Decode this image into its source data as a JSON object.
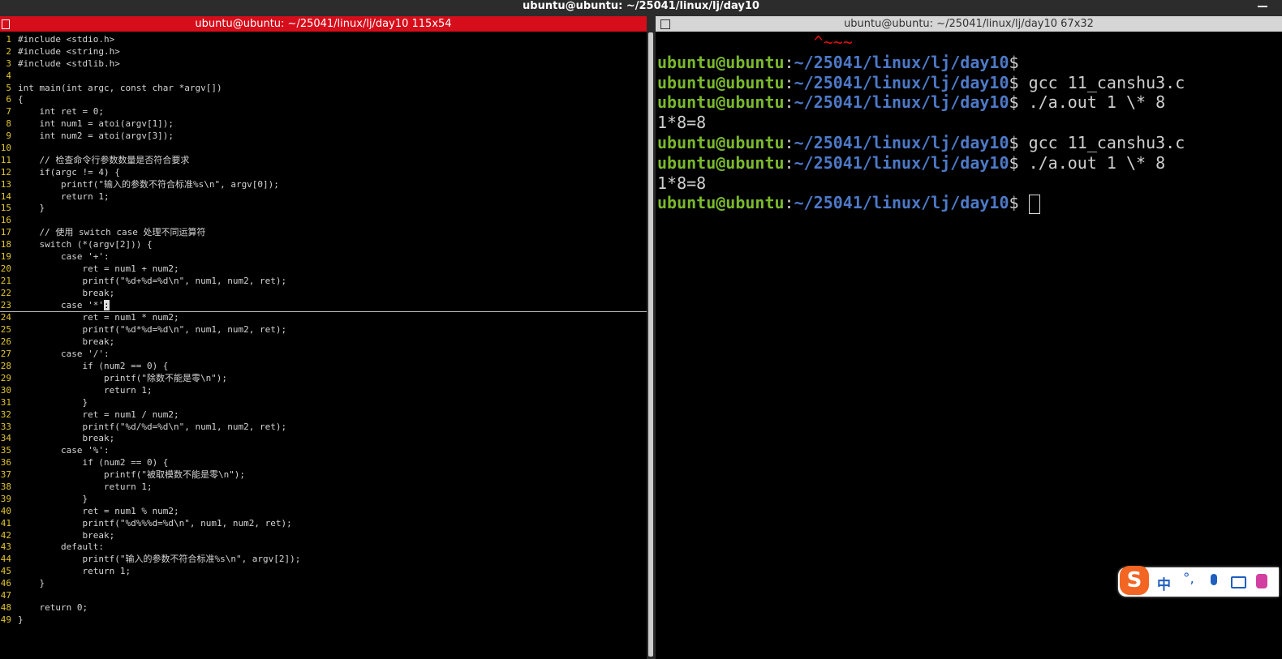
{
  "window": {
    "title": "ubuntu@ubuntu: ~/25041/linux/lj/day10"
  },
  "left_pane": {
    "title": "ubuntu@ubuntu: ~/25041/linux/lj/day10 115x54",
    "lines": [
      {
        "n": "1",
        "t": "#include <stdio.h>"
      },
      {
        "n": "2",
        "t": "#include <string.h>"
      },
      {
        "n": "3",
        "t": "#include <stdlib.h>"
      },
      {
        "n": "4",
        "t": ""
      },
      {
        "n": "5",
        "t": "int main(int argc, const char *argv[])"
      },
      {
        "n": "6",
        "t": "{"
      },
      {
        "n": "7",
        "t": "    int ret = 0;"
      },
      {
        "n": "8",
        "t": "    int num1 = atoi(argv[1]);"
      },
      {
        "n": "9",
        "t": "    int num2 = atoi(argv[3]);"
      },
      {
        "n": "10",
        "t": ""
      },
      {
        "n": "11",
        "t": "    // 检查命令行参数数量是否符合要求"
      },
      {
        "n": "12",
        "t": "    if(argc != 4) {"
      },
      {
        "n": "13",
        "t": "        printf(\"输入的参数不符合标准%s\\n\", argv[0]);"
      },
      {
        "n": "14",
        "t": "        return 1;"
      },
      {
        "n": "15",
        "t": "    }"
      },
      {
        "n": "16",
        "t": ""
      },
      {
        "n": "17",
        "t": "    // 使用 switch case 处理不同运算符"
      },
      {
        "n": "18",
        "t": "    switch (*(argv[2])) {"
      },
      {
        "n": "19",
        "t": "        case '+':"
      },
      {
        "n": "20",
        "t": "            ret = num1 + num2;"
      },
      {
        "n": "21",
        "t": "            printf(\"%d+%d=%d\\n\", num1, num2, ret);"
      },
      {
        "n": "22",
        "t": "            break;"
      },
      {
        "n": "23",
        "t": "        case '*'",
        "cursor": ":"
      },
      {
        "n": "24",
        "t": "            ret = num1 * num2;"
      },
      {
        "n": "25",
        "t": "            printf(\"%d*%d=%d\\n\", num1, num2, ret);"
      },
      {
        "n": "26",
        "t": "            break;"
      },
      {
        "n": "27",
        "t": "        case '/':"
      },
      {
        "n": "28",
        "t": "            if (num2 == 0) {"
      },
      {
        "n": "29",
        "t": "                printf(\"除数不能是零\\n\");"
      },
      {
        "n": "30",
        "t": "                return 1;"
      },
      {
        "n": "31",
        "t": "            }"
      },
      {
        "n": "32",
        "t": "            ret = num1 / num2;"
      },
      {
        "n": "33",
        "t": "            printf(\"%d/%d=%d\\n\", num1, num2, ret);"
      },
      {
        "n": "34",
        "t": "            break;"
      },
      {
        "n": "35",
        "t": "        case '%':"
      },
      {
        "n": "36",
        "t": "            if (num2 == 0) {"
      },
      {
        "n": "37",
        "t": "                printf(\"被取模数不能是零\\n\");"
      },
      {
        "n": "38",
        "t": "                return 1;"
      },
      {
        "n": "39",
        "t": "            }"
      },
      {
        "n": "40",
        "t": "            ret = num1 % num2;"
      },
      {
        "n": "41",
        "t": "            printf(\"%d%%%d=%d\\n\", num1, num2, ret);"
      },
      {
        "n": "42",
        "t": "            break;"
      },
      {
        "n": "43",
        "t": "        default:"
      },
      {
        "n": "44",
        "t": "            printf(\"输入的参数不符合标准%s\\n\", argv[2]);"
      },
      {
        "n": "45",
        "t": "            return 1;"
      },
      {
        "n": "46",
        "t": "    }"
      },
      {
        "n": "47",
        "t": ""
      },
      {
        "n": "48",
        "t": "    return 0;"
      },
      {
        "n": "49",
        "t": "}"
      }
    ]
  },
  "right_pane": {
    "title": "ubuntu@ubuntu: ~/25041/linux/lj/day10 67x32",
    "scroll_remnant": "                ^~~~",
    "prompt_user": "ubuntu@ubuntu",
    "prompt_colon": ":",
    "prompt_path": "~/25041/linux/lj/day10",
    "prompt_dollar": "$",
    "commands": [
      {
        "cmd": "",
        "output": ""
      },
      {
        "cmd": " gcc 11_canshu3.c",
        "output": ""
      },
      {
        "cmd": " ./a.out 1 \\* 8",
        "output": "1*8=8"
      },
      {
        "cmd": " gcc 11_canshu3.c",
        "output": ""
      },
      {
        "cmd": " ./a.out 1 \\* 8",
        "output": "1*8=8"
      }
    ]
  },
  "ime": {
    "logo": "S",
    "lang": "中",
    "punct": "°,"
  },
  "colors": {
    "left_title_bg": "#d60d1a",
    "prompt_user": "#7ab82c",
    "prompt_path": "#4d79c7",
    "line_number": "#e3c62e"
  }
}
